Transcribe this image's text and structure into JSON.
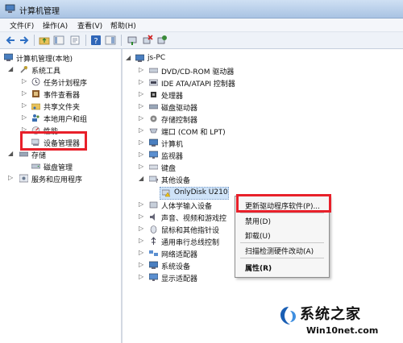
{
  "window": {
    "title": "计算机管理"
  },
  "menu": {
    "file": "文件(F)",
    "action": "操作(A)",
    "view": "查看(V)",
    "help": "帮助(H)"
  },
  "left_tree": {
    "root": "计算机管理(本地)",
    "system_tools": "系统工具",
    "task_scheduler": "任务计划程序",
    "event_viewer": "事件查看器",
    "shared_folders": "共享文件夹",
    "local_users": "本地用户和组",
    "performance": "性能",
    "device_manager": "设备管理器",
    "storage": "存储",
    "disk_management": "磁盘管理",
    "services_apps": "服务和应用程序"
  },
  "right_tree": {
    "computer": "js-PC",
    "dvd": "DVD/CD-ROM 驱动器",
    "ide": "IDE ATA/ATAPI 控制器",
    "processor": "处理器",
    "disk_drives": "磁盘驱动器",
    "storage_controllers": "存储控制器",
    "ports": "端口 (COM 和 LPT)",
    "computer_cat": "计算机",
    "monitors": "监视器",
    "keyboards": "键盘",
    "other_devices": "其他设备",
    "onlydisk": "OnlyDisk U210",
    "hid": "人体学输入设备",
    "sound": "声音、视频和游戏控",
    "mice": "鼠标和其他指针设",
    "usb": "通用串行总线控制",
    "network": "网络适配器",
    "system_devices": "系统设备",
    "display": "显示适配器"
  },
  "context_menu": {
    "update_driver": "更新驱动程序软件(P)...",
    "disable": "禁用(D)",
    "uninstall": "卸载(U)",
    "scan": "扫描检测硬件改动(A)",
    "properties": "属性(R)"
  },
  "watermark": {
    "brand": "系统之家",
    "url": "Win10net.com"
  },
  "colors": {
    "highlight_box": "#e8202a",
    "selection": "#cfe3f8"
  }
}
